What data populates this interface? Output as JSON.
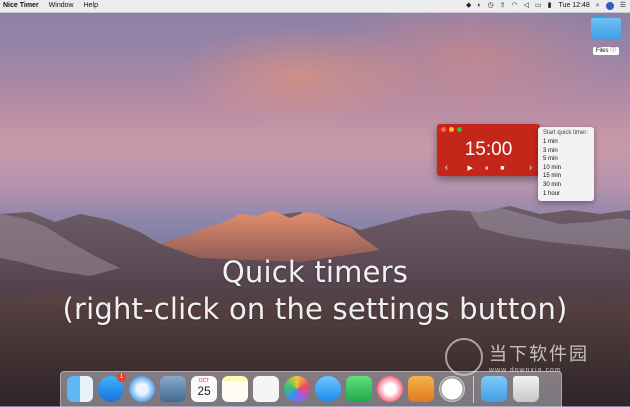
{
  "menubar": {
    "app_name": "Nice Timer",
    "menus": [
      "Window",
      "Help"
    ],
    "clock": "Tue 12:48"
  },
  "desktop": {
    "folder_label": "Files ⓘ"
  },
  "timer": {
    "time": "15:00",
    "prev": "‹",
    "next": "›",
    "controls": "▶ ⏸ ■"
  },
  "quick_menu": {
    "header": "Start quick timer:",
    "items": [
      "1 min",
      "3 min",
      "5 min",
      "10 min",
      "15 min",
      "30 min",
      "1 hour"
    ]
  },
  "caption": {
    "line1": "Quick timers",
    "line2": "(right-click on the settings button)"
  },
  "watermark": {
    "name": "当下软件园",
    "url": "www.downxia.com"
  },
  "dock": {
    "calendar_month": "OCT",
    "calendar_day": "25",
    "appstore_badge": "1"
  },
  "colors": {
    "timer_window": "#c5261a",
    "folder": "#3f9fe3"
  }
}
